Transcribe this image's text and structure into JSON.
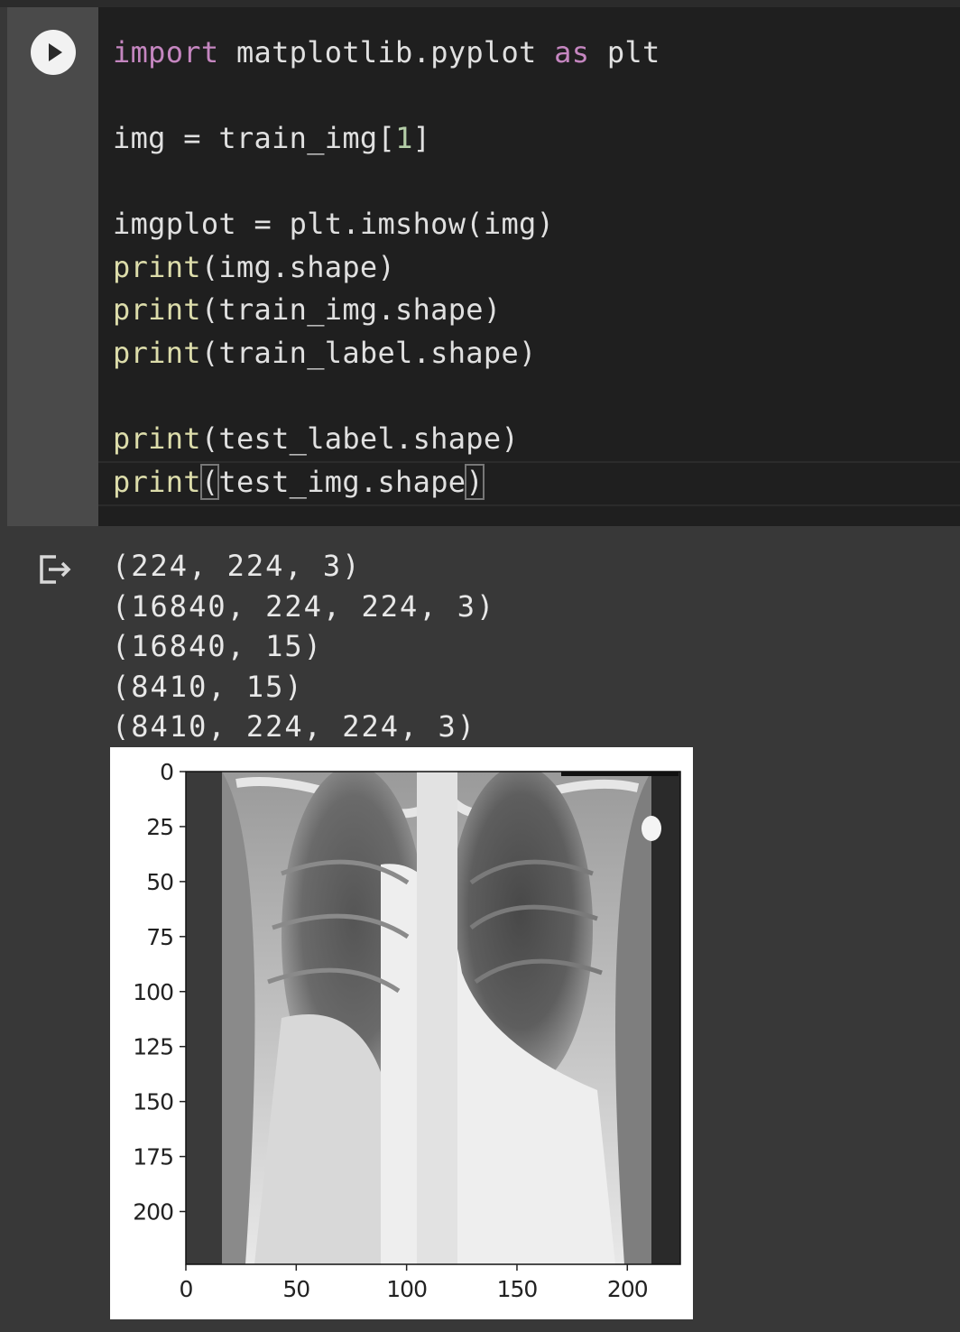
{
  "code": {
    "line1": {
      "kw1": "import",
      "mid": " matplotlib.pyplot ",
      "kw2": "as",
      "end": " plt"
    },
    "line2": {
      "pre": "img = train_img[",
      "num": "1",
      "post": "]"
    },
    "line3": "imgplot = plt.imshow(img)",
    "line4": {
      "fn": "print",
      "rest": "(img.shape)"
    },
    "line5": {
      "fn": "print",
      "rest": "(train_img.shape)"
    },
    "line6": {
      "fn": "print",
      "rest": "(train_label.shape)"
    },
    "line7": {
      "fn": "print",
      "rest": "(test_label.shape)"
    },
    "line8": {
      "fn": "print",
      "open": "(",
      "mid": "test_img.shape",
      "close": ")"
    }
  },
  "output": {
    "lines": [
      "(224, 224, 3)",
      "(16840, 224, 224, 3)",
      "(16840, 15)",
      "(8410, 15)",
      "(8410, 224, 224, 3)"
    ]
  },
  "plot": {
    "y_ticks": [
      "0",
      "25",
      "50",
      "75",
      "100",
      "125",
      "150",
      "175",
      "200"
    ],
    "x_ticks": [
      "0",
      "50",
      "100",
      "150",
      "200"
    ],
    "image_description_icon": "chest-xray-image"
  },
  "colors": {
    "keyword": "#c586c0",
    "function": "#dcdcaa",
    "number": "#b5cea8",
    "editor_bg": "#1f1f1f",
    "output_bg": "#383838"
  }
}
